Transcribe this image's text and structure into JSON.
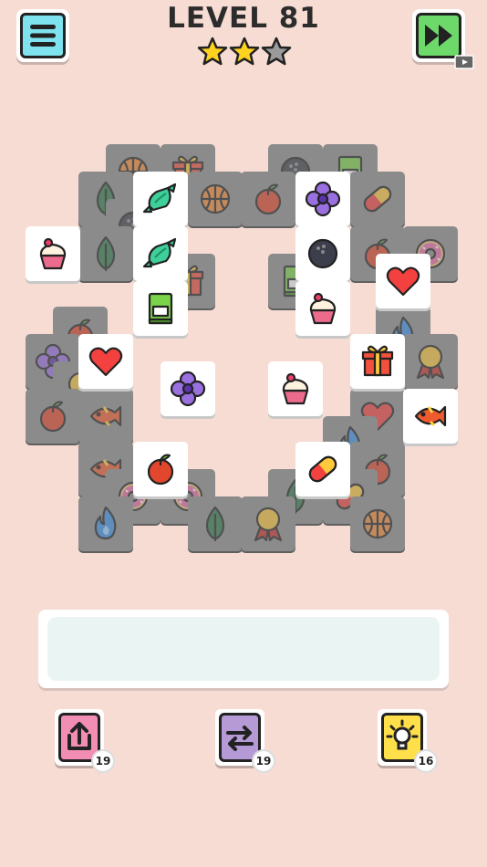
{
  "header": {
    "title": "LEVEL 81",
    "stars_filled": 2,
    "stars_total": 3
  },
  "colors": {
    "background": "#f7dcd3",
    "menu_button": "#7fe3ef",
    "skip_button": "#6ed96b",
    "star_filled": "#ffd21f",
    "star_empty": "#9b9b9b",
    "tile_covered": "#8b8b8b",
    "tile_free": "#ffffff"
  },
  "menu": {
    "icon": "hamburger-menu-icon"
  },
  "skip": {
    "icon": "fast-forward-icon",
    "badge_icon": "video-ad-icon"
  },
  "board": {
    "covered_tiles": [
      {
        "icon": "basketball"
      },
      {
        "icon": "gift"
      },
      {
        "icon": "bowling-ball"
      },
      {
        "icon": "book"
      },
      {
        "icon": "leaf"
      },
      {
        "icon": "basketball"
      },
      {
        "icon": "apple"
      },
      {
        "icon": "pill"
      },
      {
        "icon": "bowling-ball"
      },
      {
        "icon": "leaf"
      },
      {
        "icon": "gift"
      },
      {
        "icon": "book"
      },
      {
        "icon": "apple"
      },
      {
        "icon": "donut"
      },
      {
        "icon": "apple"
      },
      {
        "icon": "flame"
      },
      {
        "icon": "flower"
      },
      {
        "icon": "ribbon"
      },
      {
        "icon": "ribbon"
      },
      {
        "icon": "apple"
      },
      {
        "icon": "fish"
      },
      {
        "icon": "heart"
      },
      {
        "icon": "flame"
      },
      {
        "icon": "fish"
      },
      {
        "icon": "apple"
      },
      {
        "icon": "donut"
      },
      {
        "icon": "donut"
      },
      {
        "icon": "leaf"
      },
      {
        "icon": "pill"
      },
      {
        "icon": "flame"
      },
      {
        "icon": "leaf"
      },
      {
        "icon": "ribbon"
      },
      {
        "icon": "basketball"
      }
    ],
    "free_tiles": [
      {
        "icon": "candy"
      },
      {
        "icon": "flower"
      },
      {
        "icon": "cupcake"
      },
      {
        "icon": "candy"
      },
      {
        "icon": "bowling-ball"
      },
      {
        "icon": "heart"
      },
      {
        "icon": "book"
      },
      {
        "icon": "cupcake"
      },
      {
        "icon": "heart"
      },
      {
        "icon": "gift"
      },
      {
        "icon": "flower"
      },
      {
        "icon": "cupcake"
      },
      {
        "icon": "fish"
      },
      {
        "icon": "apple"
      },
      {
        "icon": "pill"
      }
    ]
  },
  "tray": {
    "slots_filled": 0
  },
  "tools": {
    "undo": {
      "count": "19",
      "icon": "undo-arrow-icon"
    },
    "shuffle": {
      "count": "19",
      "icon": "shuffle-icon"
    },
    "hint": {
      "count": "16",
      "icon": "lightbulb-icon"
    }
  }
}
